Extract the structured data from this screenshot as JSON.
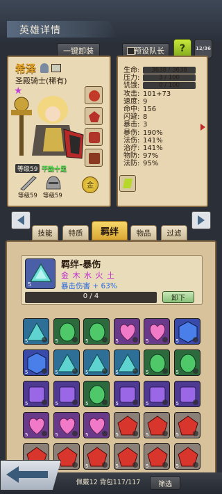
{
  "header": {
    "title": "英雄详情",
    "one_click_equip": "一键卸装",
    "preset_team": "预设队长",
    "help": "?",
    "counter": "12/36"
  },
  "hero": {
    "name": "希泽",
    "class": "圣殿骑士(稀有)",
    "level": "等级59",
    "skill_tag": "干劲十足",
    "weapon_level": "等级59",
    "armor_level": "等级59"
  },
  "stats": [
    {
      "k": "生命:",
      "v": "3638 / 3638",
      "pill": true
    },
    {
      "k": "压力:",
      "v": "3 / 100",
      "pill": true
    },
    {
      "k": "饥饿:",
      "v": "0 / 100",
      "pill": true
    },
    {
      "k": "攻击:",
      "v": "101+73"
    },
    {
      "k": "速度:",
      "v": "9"
    },
    {
      "k": "命中:",
      "v": "156"
    },
    {
      "k": "闪避:",
      "v": "8"
    },
    {
      "k": "暴击:",
      "v": "3"
    },
    {
      "k": "暴伤:",
      "v": "190%"
    },
    {
      "k": "法伤:",
      "v": "141%"
    },
    {
      "k": "治疗:",
      "v": "141%"
    },
    {
      "k": "物防:",
      "v": "97%"
    },
    {
      "k": "法防:",
      "v": "95%"
    }
  ],
  "tabs": [
    "技能",
    "特质",
    "羁绊",
    "物品",
    "过滤"
  ],
  "bond": {
    "title": "羁绊-暴伤",
    "elements": "金 木 水 火 土",
    "effect": "暴击伤害 + 63%",
    "progress": "0 / 4",
    "progress_fraction": 0,
    "level": "5",
    "unequip": "卸下"
  },
  "grid": [
    [
      "cyan",
      "green",
      "green",
      "pink",
      "pink",
      "blue"
    ],
    [
      "blue",
      "cyan",
      "cyan",
      "cyan",
      "green",
      "green"
    ],
    [
      "purple",
      "purple",
      "green",
      "purple",
      "purple",
      "purple"
    ],
    [
      "pink",
      "pink",
      "pink",
      "red",
      "red",
      "red"
    ],
    [
      "red",
      "red",
      "red",
      "red",
      "red",
      "red"
    ]
  ],
  "grid_level": "5",
  "footer": {
    "capacity": "佩戴12 背包117/117",
    "filter": "筛选"
  },
  "colors": {
    "cyan": "#5fd3d0",
    "green": "#4fc86a",
    "pink": "#f07ac8",
    "blue": "#4a7ee8",
    "purple": "#9a67e6",
    "red": "#d8352c"
  }
}
